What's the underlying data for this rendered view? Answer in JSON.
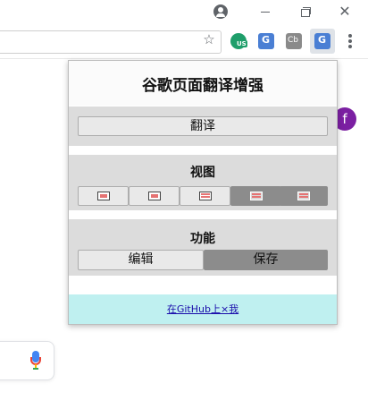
{
  "popup": {
    "title": "谷歌页面翻译增强",
    "translate_label": "翻译",
    "view_heading": "视图",
    "view_modes": [
      {
        "icon": "view-mode-1-icon",
        "active": false
      },
      {
        "icon": "view-mode-2-icon",
        "active": false
      },
      {
        "icon": "view-mode-3-icon",
        "active": false
      },
      {
        "icon": "view-mode-4-icon",
        "active": true
      },
      {
        "icon": "view-mode-5-icon",
        "active": true
      }
    ],
    "function_heading": "功能",
    "edit_label": "编辑",
    "save_label": "保存",
    "footer_link": "在GitHub上×我"
  },
  "page": {
    "avatar_letter": "f"
  },
  "colors": {
    "popup_section_bg": "#dcdcdc",
    "active_button": "#8c8c8c",
    "footer_bg": "#bff0f0",
    "avatar_bg": "#7b1fa2"
  }
}
